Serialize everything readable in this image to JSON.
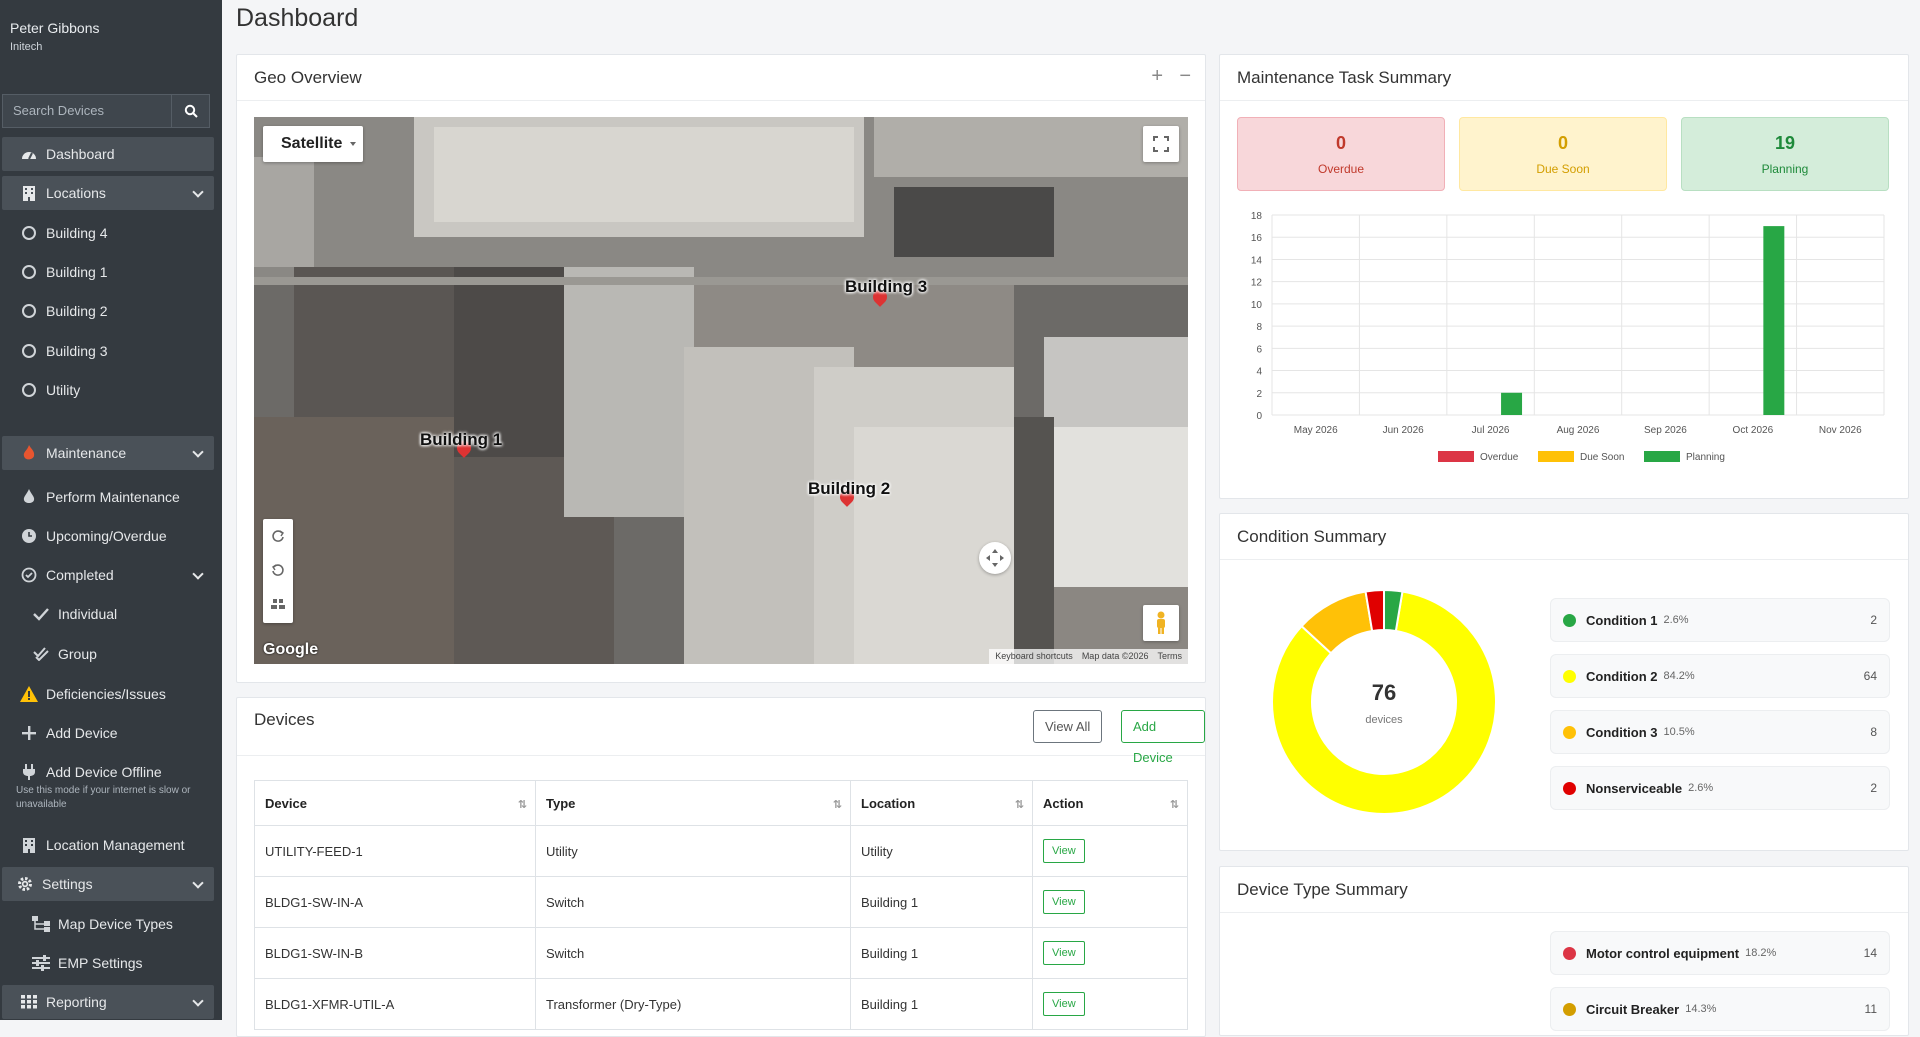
{
  "user": {
    "name": "Peter Gibbons",
    "org": "Initech"
  },
  "search": {
    "placeholder": "Search Devices"
  },
  "nav": {
    "dashboard": "Dashboard",
    "locations": "Locations",
    "location_items": [
      "Building 4",
      "Building 1",
      "Building 2",
      "Building 3",
      "Utility"
    ],
    "maintenance": "Maintenance",
    "perform": "Perform Maintenance",
    "upcoming": "Upcoming/Overdue",
    "completed": "Completed",
    "individual": "Individual",
    "group": "Group",
    "deficiencies": "Deficiencies/Issues",
    "add_device": "Add Device",
    "add_offline": "Add Device Offline",
    "offline_hint": "Use this mode if your internet is slow or unavailable",
    "location_mgmt": "Location Management",
    "settings": "Settings",
    "map_types": "Map Device Types",
    "emp": "EMP Settings",
    "reporting": "Reporting"
  },
  "page_title": "Dashboard",
  "geo": {
    "title": "Geo Overview",
    "plus": "+",
    "minus": "−",
    "map_type": "Satellite",
    "labels": [
      "Building 3",
      "Building 1",
      "Building 2"
    ],
    "google": "Google",
    "attrib": [
      "Keyboard shortcuts",
      "Map data ©2026",
      "Terms"
    ]
  },
  "devices": {
    "title": "Devices",
    "view_all": "View All",
    "add": "Add Device",
    "columns": [
      "Device",
      "Type",
      "Location",
      "Action"
    ],
    "rows": [
      {
        "device": "UTILITY-FEED-1",
        "type": "Utility",
        "location": "Utility",
        "action": "View"
      },
      {
        "device": "BLDG1-SW-IN-A",
        "type": "Switch",
        "location": "Building 1",
        "action": "View"
      },
      {
        "device": "BLDG1-SW-IN-B",
        "type": "Switch",
        "location": "Building 1",
        "action": "View"
      },
      {
        "device": "BLDG1-XFMR-UTIL-A",
        "type": "Transformer (Dry-Type)",
        "location": "Building 1",
        "action": "View"
      }
    ]
  },
  "maint_summary": {
    "title": "Maintenance Task Summary",
    "stats": [
      {
        "value": "0",
        "label": "Overdue"
      },
      {
        "value": "0",
        "label": "Due Soon"
      },
      {
        "value": "19",
        "label": "Planning"
      }
    ]
  },
  "chart_data": {
    "type": "bar",
    "categories": [
      "May 2026",
      "Jun 2026",
      "Jul 2026",
      "Aug 2026",
      "Sep 2026",
      "Oct 2026",
      "Nov 2026"
    ],
    "series": [
      {
        "name": "Overdue",
        "values": [
          0,
          0,
          0,
          0,
          0,
          0,
          0
        ],
        "color": "#dc3545"
      },
      {
        "name": "Due Soon",
        "values": [
          0,
          0,
          0,
          0,
          0,
          0,
          0
        ],
        "color": "#ffc107"
      },
      {
        "name": "Planning",
        "values": [
          0,
          0,
          2,
          0,
          0,
          17,
          0
        ],
        "color": "#28a745"
      }
    ],
    "ylim": [
      0,
      18
    ],
    "yticks": [
      "0",
      "2",
      "4",
      "6",
      "8",
      "10",
      "12",
      "14",
      "16",
      "18"
    ],
    "grid": true,
    "legend": "bottom"
  },
  "condition": {
    "title": "Condition Summary",
    "total": "76",
    "total_label": "devices",
    "items": [
      {
        "name": "Condition 1",
        "pct": "2.6%",
        "count": "2",
        "color": "#28a745"
      },
      {
        "name": "Condition 2",
        "pct": "84.2%",
        "count": "64",
        "color": "#ffff00"
      },
      {
        "name": "Condition 3",
        "pct": "10.5%",
        "count": "8",
        "color": "#ffc107"
      },
      {
        "name": "Nonserviceable",
        "pct": "2.6%",
        "count": "2",
        "color": "#e00000"
      }
    ]
  },
  "device_type": {
    "title": "Device Type Summary",
    "items": [
      {
        "name": "Motor control equipment",
        "pct": "18.2%",
        "count": "14",
        "color": "#dc3545"
      },
      {
        "name": "Circuit Breaker",
        "pct": "14.3%",
        "count": "11",
        "color": "#d39e00"
      }
    ]
  }
}
